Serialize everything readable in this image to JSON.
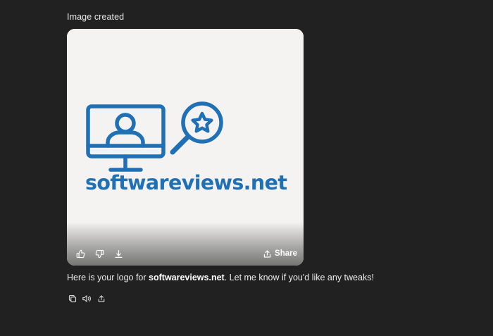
{
  "header": {
    "status": "Image created"
  },
  "image": {
    "logo_text": "softwareviews.net",
    "icon_names": [
      "computer-user-icon",
      "magnifier-star-icon"
    ],
    "logo_color": "#2070b5",
    "background_color": "#f4f3f1"
  },
  "image_actions": {
    "like_icon": "thumbs-up-icon",
    "dislike_icon": "thumbs-down-icon",
    "download_icon": "download-icon",
    "share_label": "Share"
  },
  "message": {
    "text_before": "Here is your logo for ",
    "text_bold": "softwareviews.net",
    "text_after": ". Let me know if you'd like any tweaks!"
  },
  "message_actions": {
    "copy_icon": "copy-icon",
    "read_aloud_icon": "speaker-icon",
    "share_icon": "share-icon"
  },
  "colors": {
    "page_background": "#212121",
    "text": "#ececec"
  }
}
